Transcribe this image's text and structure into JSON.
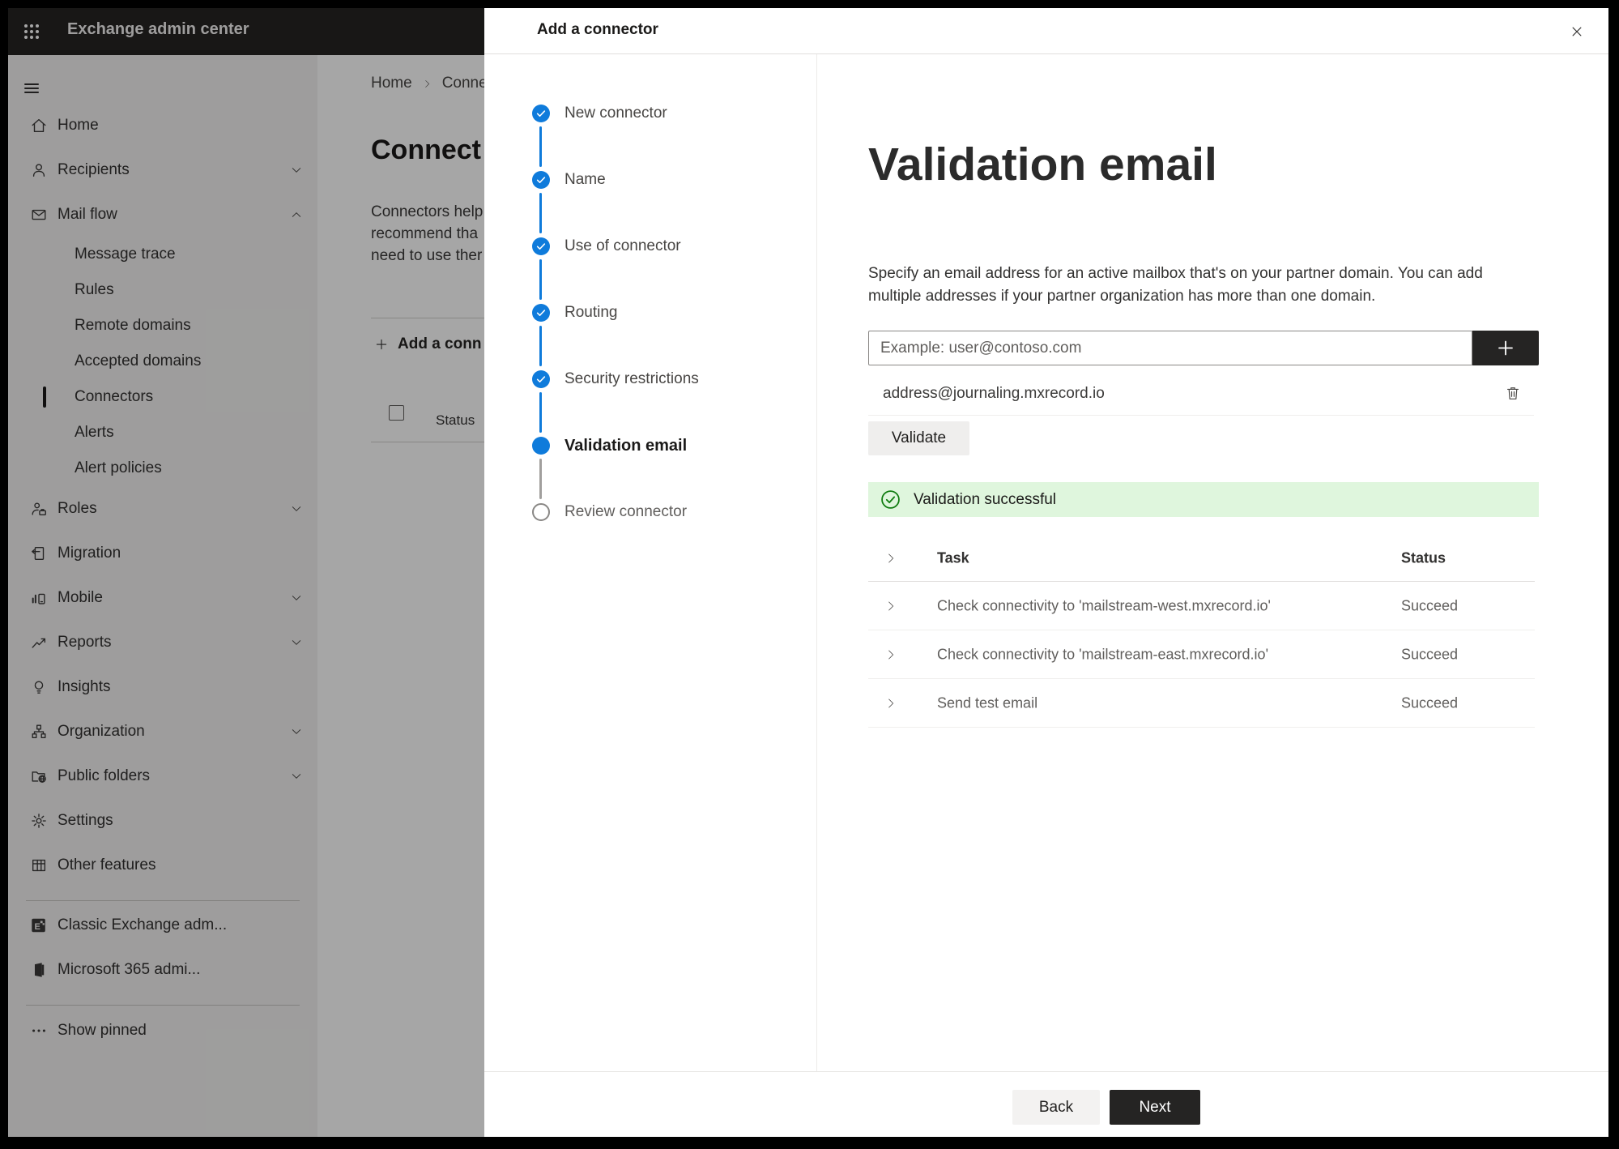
{
  "colors": {
    "accent": "#0f7bdb",
    "success": "#107c10",
    "success_bg": "#dff6dd",
    "topbar": "#252423",
    "dark_btn": "#252423"
  },
  "app": {
    "title": "Exchange admin center"
  },
  "sidebar": {
    "items": [
      {
        "label": "Home",
        "icon": "home"
      },
      {
        "label": "Recipients",
        "icon": "person",
        "chevron": "down"
      },
      {
        "label": "Mail flow",
        "icon": "mail",
        "chevron": "up"
      },
      {
        "label": "Message trace",
        "sub": true
      },
      {
        "label": "Rules",
        "sub": true
      },
      {
        "label": "Remote domains",
        "sub": true
      },
      {
        "label": "Accepted domains",
        "sub": true
      },
      {
        "label": "Connectors",
        "sub": true,
        "selected": true
      },
      {
        "label": "Alerts",
        "sub": true
      },
      {
        "label": "Alert policies",
        "sub": true
      },
      {
        "label": "Roles",
        "icon": "roles",
        "chevron": "down"
      },
      {
        "label": "Migration",
        "icon": "migration"
      },
      {
        "label": "Mobile",
        "icon": "mobile",
        "chevron": "down"
      },
      {
        "label": "Reports",
        "icon": "reports",
        "chevron": "down"
      },
      {
        "label": "Insights",
        "icon": "insights"
      },
      {
        "label": "Organization",
        "icon": "org",
        "chevron": "down"
      },
      {
        "label": "Public folders",
        "icon": "folders",
        "chevron": "down"
      },
      {
        "label": "Settings",
        "icon": "settings"
      },
      {
        "label": "Other features",
        "icon": "grid"
      }
    ],
    "footer_items": [
      {
        "label": "Classic Exchange adm...",
        "icon": "exchange"
      },
      {
        "label": "Microsoft 365 admi...",
        "icon": "m365"
      }
    ],
    "show_pinned": {
      "label": "Show pinned",
      "icon": "dots"
    }
  },
  "background": {
    "breadcrumb": {
      "home": "Home",
      "current": "Conne"
    },
    "heading": "Connect",
    "paragraph_lines": [
      "Connectors help",
      "recommend tha",
      "need to use ther"
    ],
    "add_button": "Add a conn",
    "status_header": "Status"
  },
  "dialog": {
    "title": "Add a connector",
    "steps": [
      {
        "label": "New connector",
        "state": "done",
        "line": "blue"
      },
      {
        "label": "Name",
        "state": "done",
        "line": "blue"
      },
      {
        "label": "Use of connector",
        "state": "done",
        "line": "blue"
      },
      {
        "label": "Routing",
        "state": "done",
        "line": "blue"
      },
      {
        "label": "Security restrictions",
        "state": "done",
        "line": "blue"
      },
      {
        "label": "Validation email",
        "state": "current",
        "line": "gray"
      },
      {
        "label": "Review connector",
        "state": "todo"
      }
    ],
    "content": {
      "heading": "Validation email",
      "description_lines": [
        "Specify an email address for an active mailbox that's on your partner domain. You can add",
        "multiple addresses if your partner organization has more than one domain."
      ],
      "input_placeholder": "Example: user@contoso.com",
      "address": "address@journaling.mxrecord.io",
      "validate_label": "Validate",
      "banner_text": "Validation successful",
      "table": {
        "task_header": "Task",
        "status_header": "Status",
        "rows": [
          {
            "task": "Check connectivity to 'mailstream-west.mxrecord.io'",
            "status": "Succeed"
          },
          {
            "task": "Check connectivity to 'mailstream-east.mxrecord.io'",
            "status": "Succeed"
          },
          {
            "task": "Send test email",
            "status": "Succeed"
          }
        ]
      }
    },
    "footer": {
      "back": "Back",
      "next": "Next"
    }
  }
}
